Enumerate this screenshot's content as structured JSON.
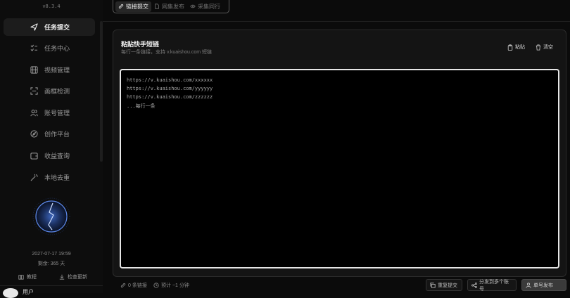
{
  "app": {
    "version": "v8.3.4"
  },
  "sidebar": {
    "items": [
      {
        "label": "任务提交",
        "icon": "send-icon",
        "active": true
      },
      {
        "label": "任务中心",
        "icon": "task-list-icon",
        "active": false
      },
      {
        "label": "视频管理",
        "icon": "film-icon",
        "active": false
      },
      {
        "label": "画框检测",
        "icon": "frame-scan-icon",
        "active": false
      },
      {
        "label": "账号管理",
        "icon": "users-icon",
        "active": false
      },
      {
        "label": "创作平台",
        "icon": "compass-icon",
        "active": false
      },
      {
        "label": "收益查询",
        "icon": "wallet-icon",
        "active": false
      },
      {
        "label": "本地去重",
        "icon": "magic-wand-icon",
        "active": false
      }
    ],
    "date": "2027-07-17 19:59",
    "remaining": "剩余: 365 天",
    "tutorial_label": "教程",
    "update_label": "检查更新",
    "username": "用户"
  },
  "tabs": [
    {
      "label": "链接提交",
      "icon": "link-icon",
      "active": true
    },
    {
      "label": "网集发布",
      "icon": "file-icon",
      "active": false
    },
    {
      "label": "采集同行",
      "icon": "eye-icon",
      "active": false
    }
  ],
  "card": {
    "title": "粘贴快手短链",
    "subtitle": "每行一条链接，支持 v.kuaishou.com 短链",
    "paste_label": "粘贴",
    "clear_label": "清空"
  },
  "textarea": {
    "placeholder_lines": [
      "https://v.kuaishou.com/xxxxxx",
      "https://v.kuaishou.com/yyyyyy",
      "https://v.kuaishou.com/zzzzzz",
      "...每行一条"
    ]
  },
  "footer": {
    "link_count": "0 条链接",
    "estimate": "预计 ~1 分钟",
    "resubmit_label": "重复提交",
    "distribute_label": "分发到多个账号",
    "publish_label": "单号发布"
  },
  "colors": {
    "background": "#0b0b0b",
    "card": "#141414",
    "active_tab": "#262626",
    "textarea_border": "#e6e6e6",
    "orb_glow": "#4a7fe0"
  }
}
